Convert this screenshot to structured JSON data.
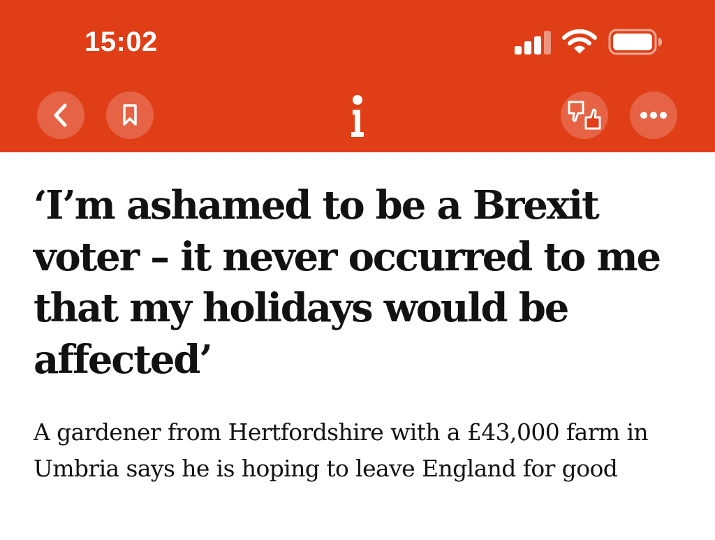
{
  "status_bar": {
    "time": "15:02",
    "icons": [
      "cellular-signal-icon",
      "wifi-icon",
      "battery-icon"
    ]
  },
  "toolbar": {
    "left_buttons": [
      "back-icon",
      "bookmark-icon"
    ],
    "logo_text": "i",
    "right_buttons": [
      "reactions-icon",
      "more-icon"
    ]
  },
  "article": {
    "headline": "‘I’m ashamed to be a Brexit voter – it never occurred to me that my holidays would be affected’",
    "standfirst": "A gardener from Hertfordshire with a £43,000 farm in Umbria says he is hoping to leave England for good"
  },
  "colors": {
    "brand_bar": "#e03e17",
    "button_bg": "rgba(255,255,255,0.2)",
    "text": "#121212",
    "background": "#ffffff"
  }
}
